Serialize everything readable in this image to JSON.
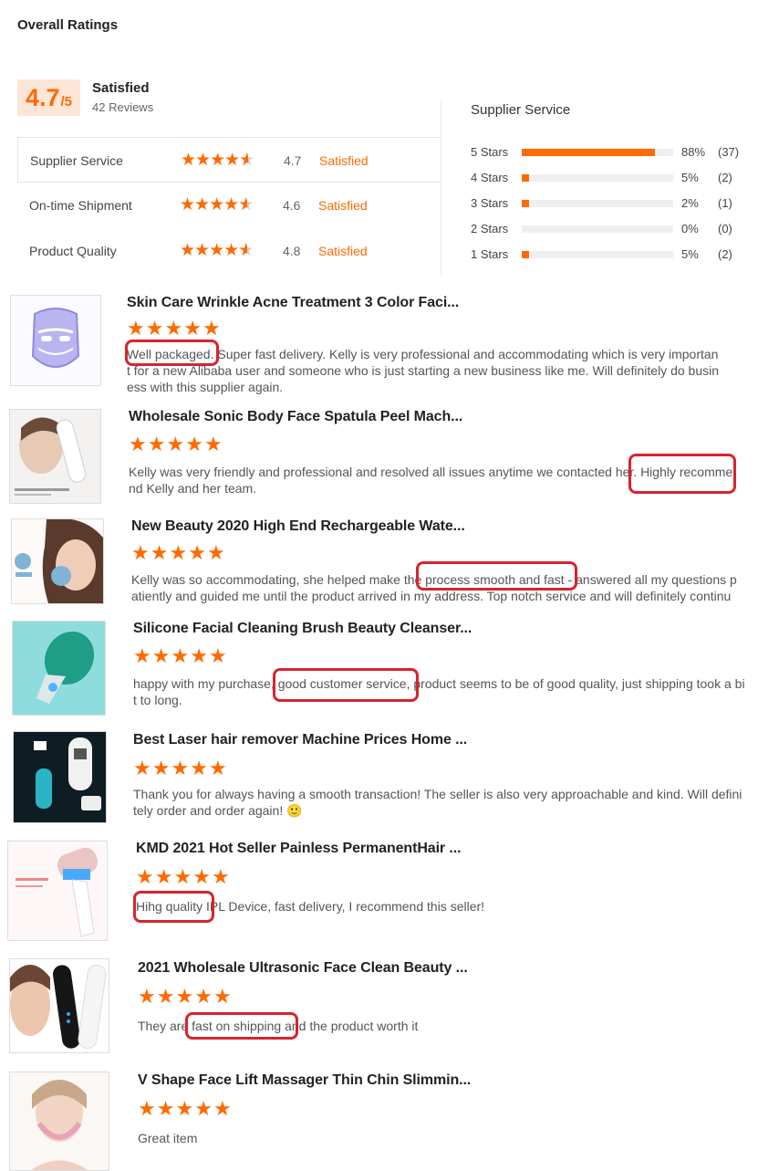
{
  "header": {
    "title": "Overall Ratings"
  },
  "summary": {
    "score": "4.7",
    "score_den": "/5",
    "label": "Satisfied",
    "reviews": "42 Reviews"
  },
  "metrics": [
    {
      "name": "Supplier Service",
      "rating": 4.7,
      "value": "4.7",
      "status": "Satisfied"
    },
    {
      "name": "On-time Shipment",
      "rating": 4.6,
      "value": "4.6",
      "status": "Satisfied"
    },
    {
      "name": "Product Quality",
      "rating": 4.8,
      "value": "4.8",
      "status": "Satisfied"
    }
  ],
  "distribution": {
    "title": "Supplier Service",
    "rows": [
      {
        "label": "5 Stars",
        "pct": "88%",
        "count": "(37)",
        "fraction": 0.88
      },
      {
        "label": "4 Stars",
        "pct": "5%",
        "count": "(2)",
        "fraction": 0.05
      },
      {
        "label": "3 Stars",
        "pct": "2%",
        "count": "(1)",
        "fraction": 0.02
      },
      {
        "label": "2 Stars",
        "pct": "0%",
        "count": "(0)",
        "fraction": 0
      },
      {
        "label": "1 Stars",
        "pct": "5%",
        "count": "(2)",
        "fraction": 0.05
      }
    ]
  },
  "reviews": [
    {
      "title": "Skin Care Wrinkle Acne Treatment 3 Color Faci...",
      "rating": 5,
      "text": "Well packaged. Super fast delivery. Kelly is very professional and accommodating which is very important for a new Alibaba user and someone who is just starting a new business like me. Will definitely do business with this supplier again."
    },
    {
      "title": "Wholesale Sonic Body Face Spatula Peel Mach...",
      "rating": 5,
      "text": "Kelly was very friendly and professional and resolved all issues anytime we contacted her. Highly recommend Kelly and her team."
    },
    {
      "title": "New Beauty 2020 High End Rechargeable Wate...",
      "rating": 5,
      "text": "Kelly was so accommodating, she helped make the process smooth and fast - answered all my questions patiently and guided me until the product arrived in my address. Top notch service and will definitely continu"
    },
    {
      "title": "Silicone Facial Cleaning Brush Beauty Cleanser...",
      "rating": 5,
      "text": "happy with my purchase, good customer service, product seems to be of good quality, just shipping took a bit to long."
    },
    {
      "title": "Best Laser hair remover Machine Prices Home ...",
      "rating": 5,
      "text": "Thank you for always having a smooth transaction! The seller is also very approachable and kind. Will definitely order and order again! 🙂"
    },
    {
      "title": "KMD 2021 Hot Seller Painless PermanentHair ...",
      "rating": 5,
      "text": "Hihg quality IPL Device, fast delivery, I recommend this seller!"
    },
    {
      "title": "2021 Wholesale Ultrasonic Face Clean Beauty ...",
      "rating": 5,
      "text": "They are fast on shipping and the product worth it"
    },
    {
      "title": "V Shape Face Lift Massager Thin Chin Slimmin...",
      "rating": 5,
      "text": "Great item"
    }
  ],
  "colors": {
    "accent": "#ff6a00",
    "highlight": "#d9232d"
  }
}
